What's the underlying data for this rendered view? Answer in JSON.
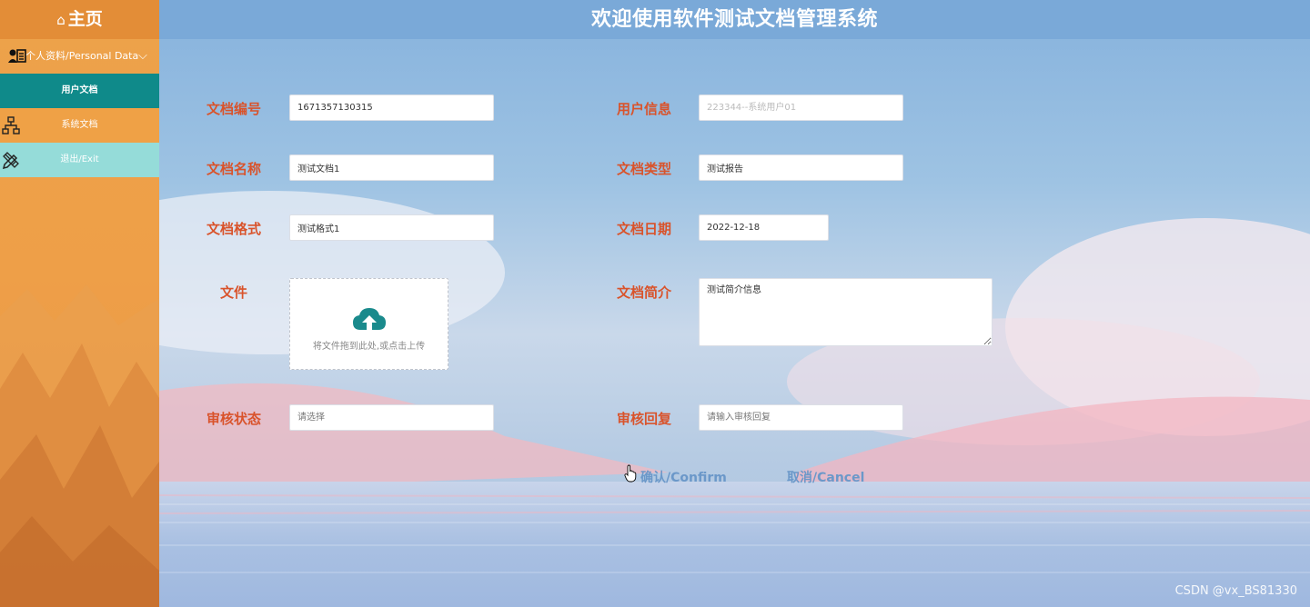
{
  "sidebar": {
    "home_label": "主页",
    "personal_label": "个人资料/Personal Data",
    "items": [
      {
        "label": "用户文档",
        "active": true
      },
      {
        "label": "系统文档",
        "icon": "sitemap-icon"
      },
      {
        "label": "退出/Exit",
        "icon": "pencil-ruler-icon"
      }
    ]
  },
  "header": {
    "title": "欢迎使用软件测试文档管理系统"
  },
  "form": {
    "doc_number": {
      "label": "文档编号",
      "value": "1671357130315"
    },
    "user_info": {
      "label": "用户信息",
      "placeholder": "223344--系统用户01"
    },
    "doc_name": {
      "label": "文档名称",
      "value": "测试文档1"
    },
    "doc_type": {
      "label": "文档类型",
      "value": "测试报告"
    },
    "doc_format": {
      "label": "文档格式",
      "value": "测试格式1"
    },
    "doc_date": {
      "label": "文档日期",
      "value": "2022-12-18"
    },
    "file": {
      "label": "文件",
      "upload_hint": "将文件拖到此处,或点击上传"
    },
    "doc_intro": {
      "label": "文档简介",
      "value": "测试简介信息"
    },
    "review_status": {
      "label": "审核状态",
      "placeholder": "请选择"
    },
    "review_reply": {
      "label": "审核回复",
      "placeholder": "请输入审核回复"
    }
  },
  "actions": {
    "confirm_label": "确认/Confirm",
    "cancel_label": "取消/Cancel"
  },
  "watermark": "CSDN @vx_BS81330",
  "colors": {
    "label_red": "#d9532b",
    "accent_teal": "#0f8a8a",
    "sidebar_orange": "#eda24a",
    "button_blue": "#6b98c9"
  }
}
